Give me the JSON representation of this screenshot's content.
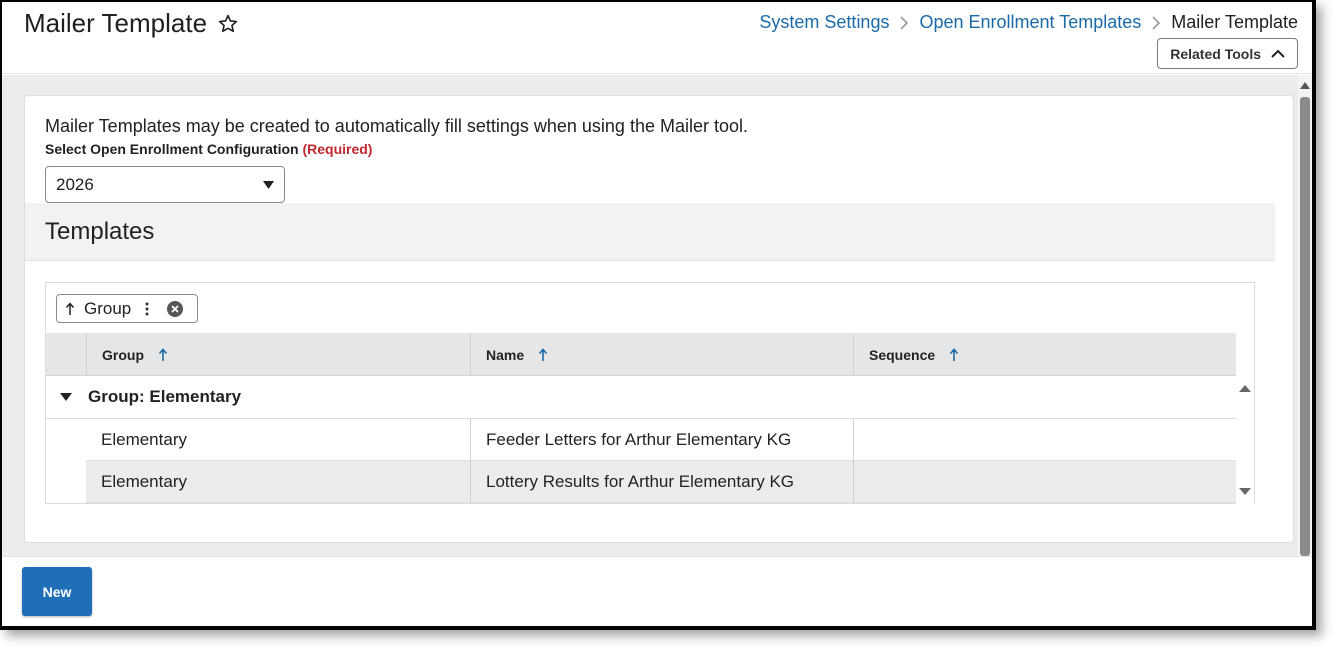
{
  "header": {
    "title": "Mailer Template",
    "breadcrumb": [
      "System Settings",
      "Open Enrollment Templates",
      "Mailer Template"
    ],
    "related_tools_label": "Related Tools"
  },
  "main": {
    "intro": "Mailer Templates may be created to automatically fill settings when using the Mailer tool.",
    "config_label": "Select Open Enrollment Configuration",
    "required_text": "(Required)",
    "config_value": "2026",
    "section_title": "Templates"
  },
  "grid": {
    "group_chip_label": "Group",
    "columns": [
      "Group",
      "Name",
      "Sequence"
    ],
    "group_row_label": "Group: Elementary",
    "rows": [
      {
        "group": "Elementary",
        "name": "Feeder Letters for Arthur Elementary KG",
        "sequence": ""
      },
      {
        "group": "Elementary",
        "name": "Lottery Results for Arthur Elementary KG",
        "sequence": ""
      }
    ]
  },
  "footer": {
    "new_label": "New"
  },
  "colors": {
    "link": "#1a6aa8",
    "required": "#c0282d",
    "primary_button": "#1f6fb8"
  },
  "icons": [
    "star-icon",
    "chevron-right-icon",
    "chevron-up-icon",
    "caret-down-icon",
    "arrow-up-icon",
    "kebab-menu-icon",
    "close-circle-icon",
    "expand-caret-icon",
    "scroll-up-icon",
    "scroll-down-icon"
  ]
}
